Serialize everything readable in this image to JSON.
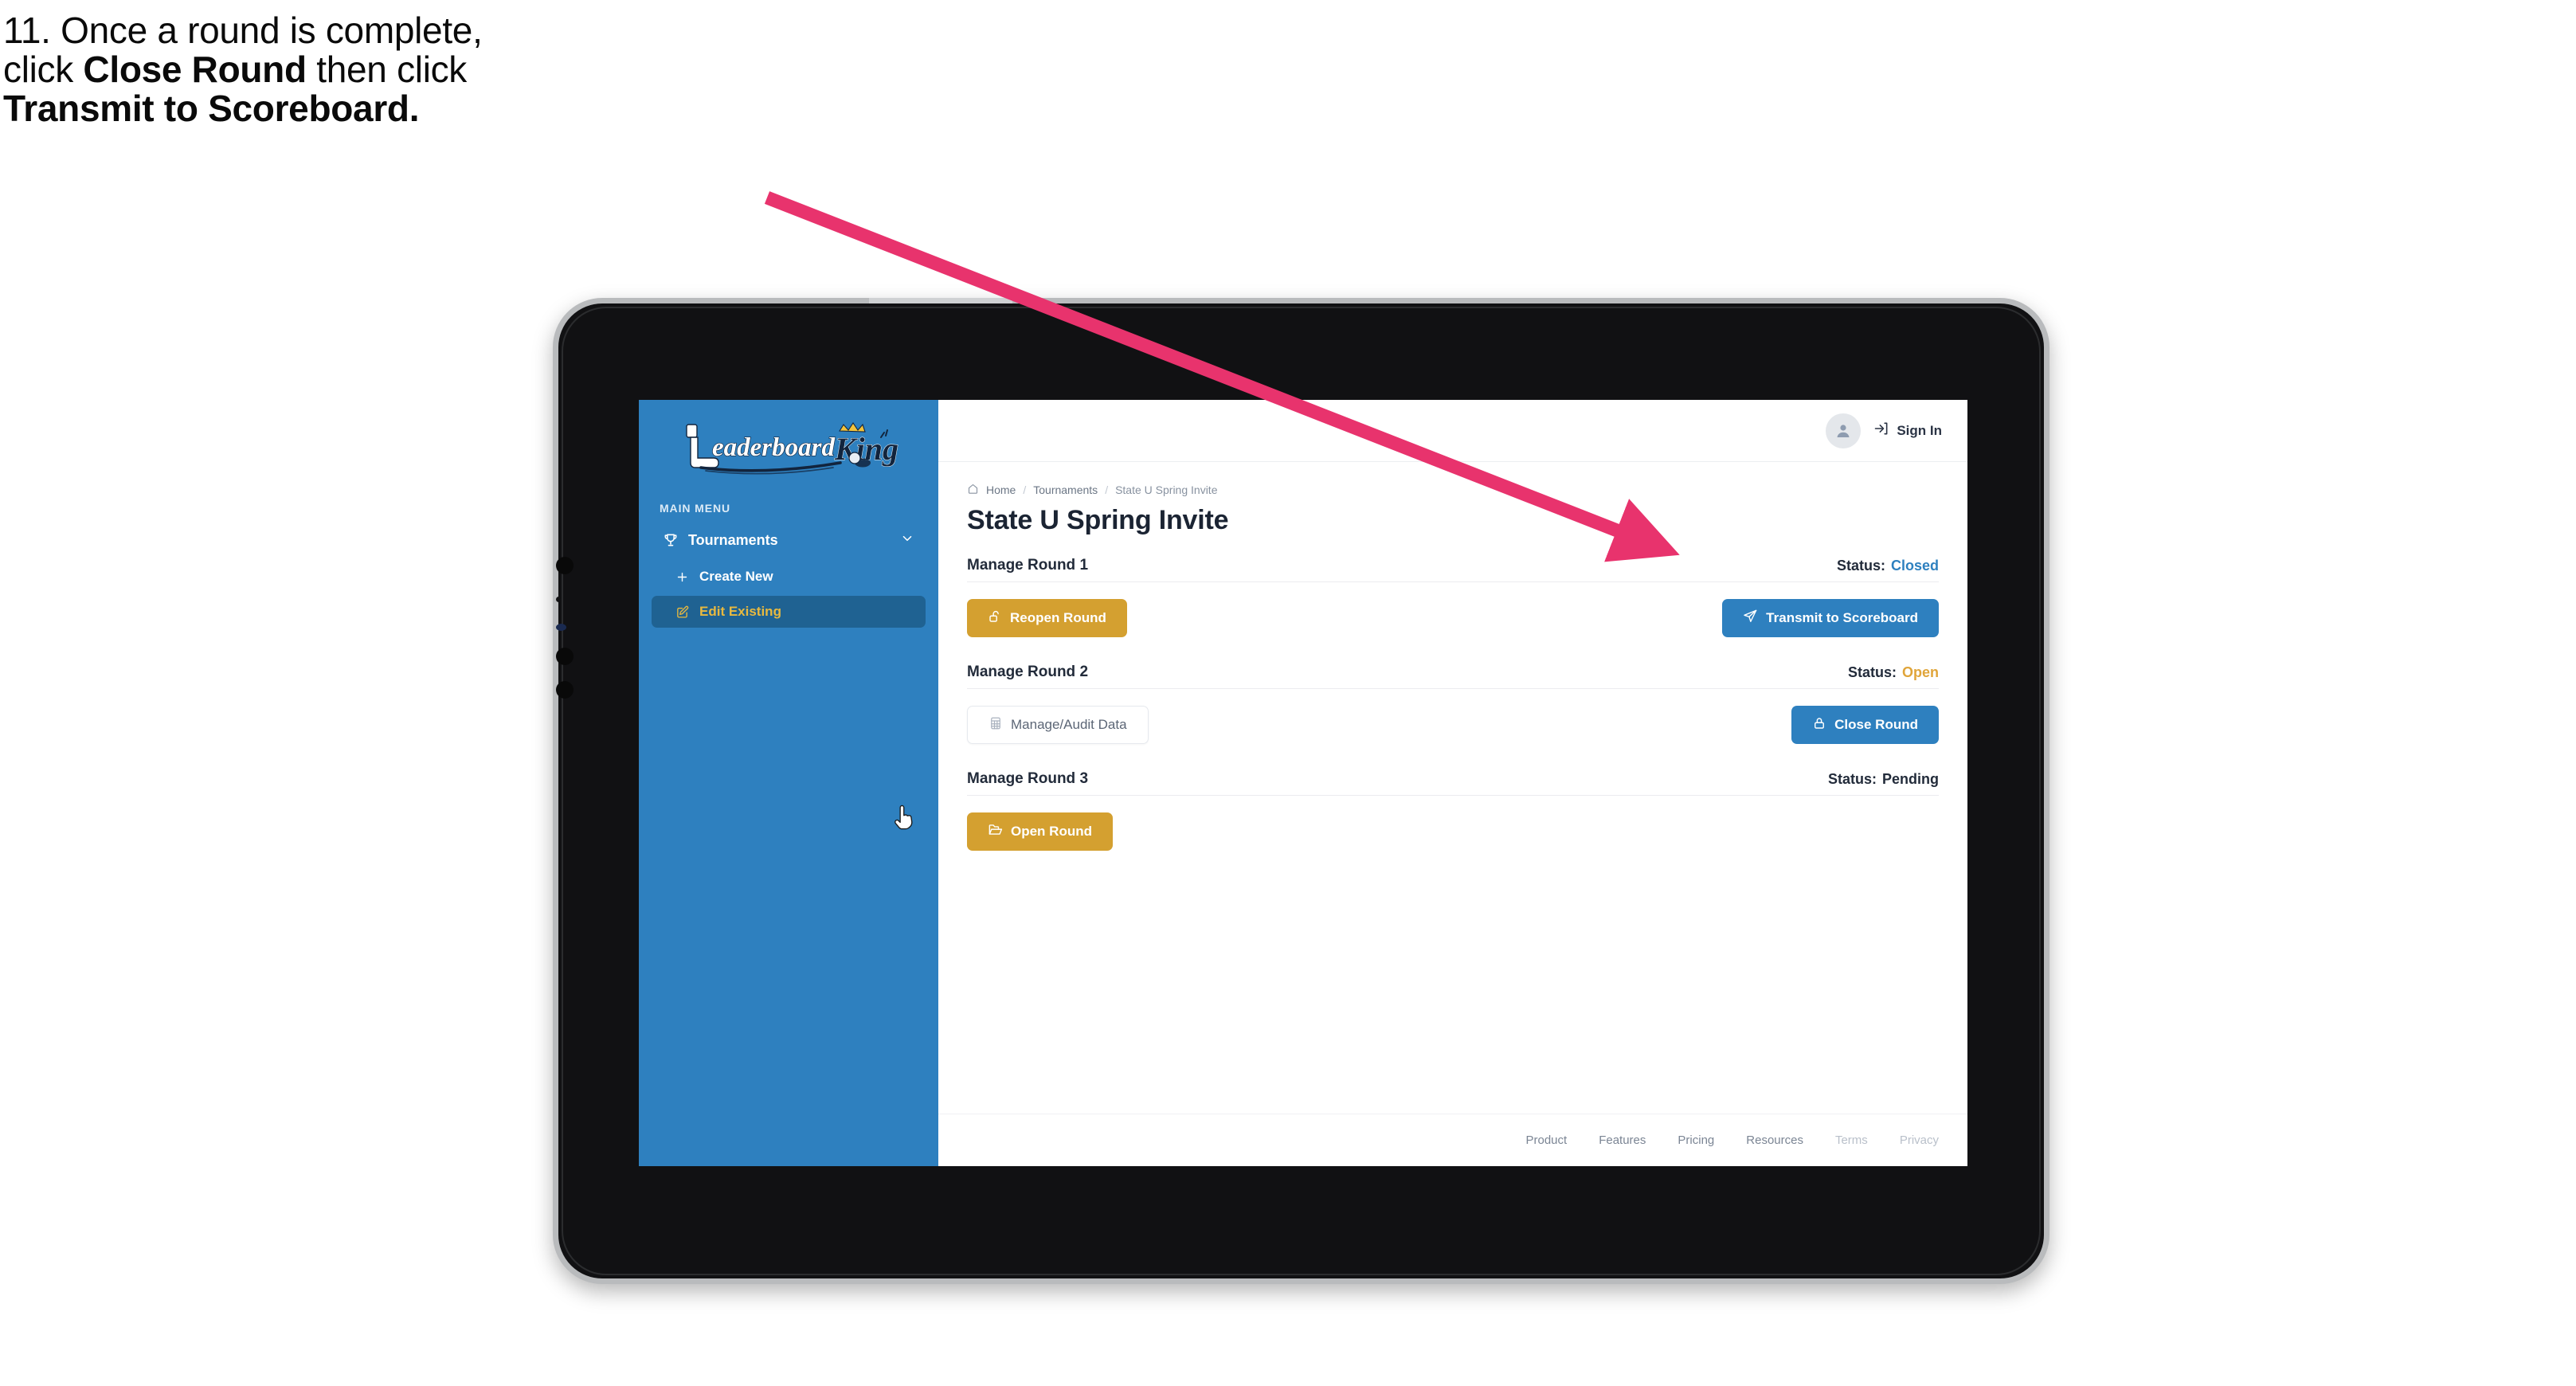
{
  "caption": {
    "line1_plain": "11. Once a round is complete,",
    "line2_pre": "click ",
    "line2_bold": "Close Round",
    "line2_post": " then click",
    "line3_bold": "Transmit to Scoreboard."
  },
  "annotation": {
    "arrow_color": "#e8336d"
  },
  "colors": {
    "sidebar_blue": "#2e80bf",
    "sidebar_active": "#1f6292",
    "accent_gold": "#d4a030",
    "active_text_gold": "#e8b93f",
    "status_closed": "#2e80bf",
    "status_open": "#e0a53a",
    "status_pending": "#222b3a",
    "text_dark": "#1b2433",
    "device_bezel": "#111113",
    "device_edge": "#b9bbbd"
  },
  "app": {
    "logo": {
      "word_one": "Leaderboard",
      "word_two": "King",
      "icon_name": "golf-club-crown-logo"
    },
    "sidebar": {
      "section_label": "MAIN MENU",
      "items": [
        {
          "label": "Tournaments",
          "icon": "trophy-icon",
          "chevron": "chevron-down-icon",
          "active": false
        },
        {
          "label": "Create New",
          "icon": "plus-icon",
          "active": false
        },
        {
          "label": "Edit Existing",
          "icon": "edit-pencil-icon",
          "active": true
        }
      ]
    },
    "topbar": {
      "avatar_icon": "user-avatar-icon",
      "signin_icon": "sign-in-arrow-icon",
      "signin_label": "Sign In"
    },
    "breadcrumb": {
      "home_icon": "home-icon",
      "items": [
        "Home",
        "Tournaments",
        "State U Spring Invite"
      ],
      "separator": "/"
    },
    "page_title": "State U Spring Invite",
    "status_prefix": "Status:",
    "rounds": [
      {
        "name": "Manage Round 1",
        "status_label": "Status:",
        "status_value": "Closed",
        "status_class": "val-closed",
        "left_button": {
          "label": "Reopen Round",
          "icon": "unlock-icon",
          "style": "btn-gold"
        },
        "right_button": {
          "label": "Transmit to Scoreboard",
          "icon": "paper-plane-icon",
          "style": "btn-blue"
        }
      },
      {
        "name": "Manage Round 2",
        "status_label": "Status:",
        "status_value": "Open",
        "status_class": "val-open",
        "left_button": {
          "label": "Manage/Audit Data",
          "icon": "table-grid-icon",
          "style": "btn-ghost"
        },
        "right_button": {
          "label": "Close Round",
          "icon": "lock-icon",
          "style": "btn-blue"
        }
      },
      {
        "name": "Manage Round 3",
        "status_label": "Status:",
        "status_value": "Pending",
        "status_class": "val-pending",
        "left_button": {
          "label": "Open Round",
          "icon": "folder-open-icon",
          "style": "btn-gold"
        },
        "right_button": null
      }
    ],
    "footer": {
      "links": [
        {
          "label": "Product",
          "dim": false
        },
        {
          "label": "Features",
          "dim": false
        },
        {
          "label": "Pricing",
          "dim": false
        },
        {
          "label": "Resources",
          "dim": false
        },
        {
          "label": "Terms",
          "dim": true
        },
        {
          "label": "Privacy",
          "dim": true
        }
      ]
    },
    "cursor": {
      "icon": "pointing-hand-cursor"
    }
  }
}
